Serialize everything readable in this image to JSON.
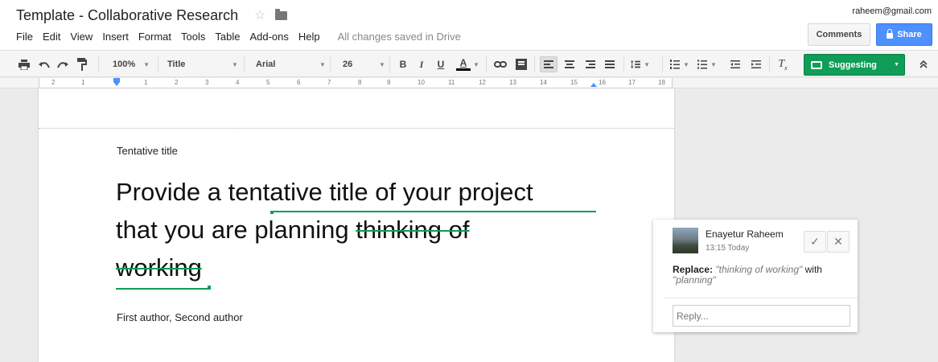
{
  "header": {
    "doc_title": "Template - Collaborative Research",
    "menu": [
      "File",
      "Edit",
      "View",
      "Insert",
      "Format",
      "Tools",
      "Table",
      "Add-ons",
      "Help"
    ],
    "saved_status": "All changes saved in Drive",
    "user_email": "raheem@gmail.com",
    "comments_label": "Comments",
    "share_label": "Share"
  },
  "toolbar": {
    "zoom": "100%",
    "style": "Title",
    "font": "Arial",
    "font_size": "26",
    "bold": "B",
    "italic": "I",
    "underline": "U",
    "text_color": "A",
    "mode_label": "Suggesting"
  },
  "ruler": {
    "numbers": [
      "2",
      "1",
      "1",
      "2",
      "3",
      "4",
      "5",
      "6",
      "7",
      "8",
      "9",
      "10",
      "11",
      "12",
      "13",
      "14",
      "15",
      "16",
      "17",
      "18"
    ]
  },
  "document": {
    "section_label": "Tentative title",
    "line1": "Provide a tentative title of your project",
    "line2_start": "that you are ",
    "line2_inserted": "planning",
    "line2_space": " ",
    "line2_deleted": "thinking of",
    "line3_deleted": "working",
    "authors": "First author, Second author"
  },
  "comment": {
    "author": "Enayetur Raheem",
    "time": "13:15 Today",
    "replace_label": "Replace:",
    "old_text": "\"thinking of working\"",
    "with_label": "with",
    "new_text": "\"planning\"",
    "reply_placeholder": "Reply..."
  },
  "colors": {
    "suggest_green": "#0f9d58",
    "share_blue": "#4d90fe"
  }
}
